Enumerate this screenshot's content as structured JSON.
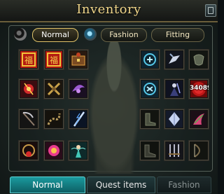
{
  "window": {
    "title": "Inventory"
  },
  "filters": [
    {
      "label": "Normal",
      "active": true
    },
    {
      "label": "Fashion",
      "active": false
    },
    {
      "label": "Fitting",
      "active": false
    }
  ],
  "bottom_tabs": [
    {
      "label": "Normal",
      "state": "active"
    },
    {
      "label": "Quest items",
      "state": "normal"
    },
    {
      "label": "Fashion",
      "state": "disabled"
    }
  ],
  "colors": {
    "title": "#f0d68a",
    "tab_active": "#1a9a9e",
    "accent_gold": "#e0c36a"
  },
  "left_slots": [
    {
      "icon": "fortune-charm-icon"
    },
    {
      "icon": "fortune-charm-icon"
    },
    {
      "icon": "chest-icon"
    },
    {
      "icon": "amulet-icon"
    },
    {
      "icon": "armor-icon"
    },
    {
      "icon": "purple-wings-icon"
    },
    {
      "icon": "scythe-icon"
    },
    {
      "icon": "chain-icon"
    },
    {
      "icon": "lightning-blade-icon"
    },
    {
      "icon": "red-necklace-icon"
    },
    {
      "icon": "magic-ring-icon"
    },
    {
      "icon": "fairy-icon"
    }
  ],
  "right_slots": [
    {
      "icon": "rune-icon"
    },
    {
      "icon": "mount-icon"
    },
    {
      "icon": "bracer-icon"
    },
    {
      "icon": "rune-icon"
    },
    {
      "icon": "dark-mage-icon"
    },
    {
      "icon": "coin-stack-icon",
      "count": "34089"
    },
    {
      "icon": "boots-icon"
    },
    {
      "icon": "crystal-armor-icon"
    },
    {
      "icon": "pink-claw-icon"
    },
    {
      "icon": "dark-boots-icon"
    },
    {
      "icon": "blade-set-icon"
    },
    {
      "icon": "bow-icon"
    }
  ]
}
